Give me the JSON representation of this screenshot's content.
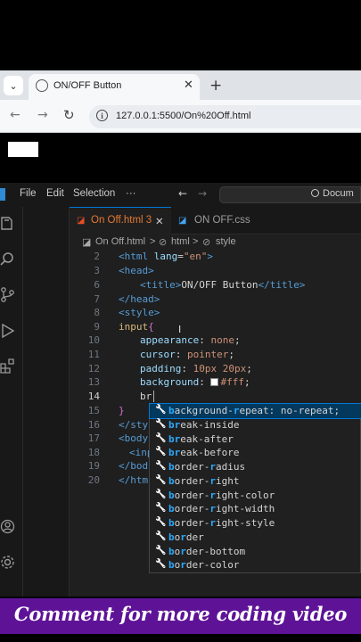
{
  "browser": {
    "tab_title": "ON/OFF Button",
    "tab_close": "✕",
    "new_tab": "+",
    "dropdown": "⌄",
    "url": "127.0.0.1:5500/On%20Off.html",
    "info": "i"
  },
  "vscode": {
    "menu": [
      "File",
      "Edit",
      "Selection",
      "···"
    ],
    "command_center": "Docum",
    "tabs": [
      {
        "label": "On Off.html",
        "badge": "3",
        "close": "✕"
      },
      {
        "label": "ON OFF.css"
      }
    ],
    "breadcrumb": [
      "On Off.html",
      ">",
      "html",
      ">",
      "style"
    ],
    "line_numbers": [
      "2",
      "3",
      "6",
      "7",
      "8",
      "9",
      "10",
      "11",
      "12",
      "13",
      "14",
      "15",
      "16",
      "17",
      "18",
      "19",
      "20"
    ],
    "code": {
      "l2": {
        "open": "<html",
        "attr": " lang",
        "eq": "=",
        "val": "\"en\"",
        "close": ">"
      },
      "l3": "<head>",
      "l6": {
        "open": "<title>",
        "text": "ON/OFF Button",
        "close": "</title>"
      },
      "l7": "</head>",
      "l8": "<style>",
      "l9": {
        "sel": "input",
        "brace": "{"
      },
      "l10": {
        "prop": "appearance",
        "colon": ": ",
        "val": "none",
        "semi": ";"
      },
      "l11": {
        "prop": "cursor",
        "colon": ": ",
        "val": "pointer",
        "semi": ";"
      },
      "l12": {
        "prop": "padding",
        "colon": ": ",
        "val": "10px 20px",
        "semi": ";"
      },
      "l13": {
        "prop": "background",
        "colon": ": ",
        "val": "#fff",
        "semi": ";"
      },
      "l14": "br",
      "l15": "}",
      "l16": "</styl",
      "l17": "<body",
      "l18": "<inp",
      "l19": "</body",
      "l20": "</html"
    },
    "suggestions": [
      {
        "match": "b",
        "mid": "ackground-",
        "match2": "r",
        "rest": "epeat: no-repeat;"
      },
      {
        "match": "br",
        "rest": "eak-inside"
      },
      {
        "match": "br",
        "rest": "eak-after"
      },
      {
        "match": "br",
        "rest": "eak-before"
      },
      {
        "match": "b",
        "mid": "order-",
        "match2": "r",
        "rest": "adius"
      },
      {
        "match": "b",
        "mid": "order-",
        "match2": "r",
        "rest": "ight"
      },
      {
        "match": "b",
        "mid": "order-",
        "match2": "r",
        "rest": "ight-color"
      },
      {
        "match": "b",
        "mid": "order-",
        "match2": "r",
        "rest": "ight-width"
      },
      {
        "match": "b",
        "mid": "order-",
        "match2": "r",
        "rest": "ight-style"
      },
      {
        "match": "b",
        "mid": "o",
        "match2": "r",
        "rest": "der"
      },
      {
        "match": "b",
        "mid": "o",
        "match2": "r",
        "rest": "der-bottom"
      },
      {
        "match": "b",
        "mid": "o",
        "match2": "r",
        "rest": "der-color"
      }
    ],
    "suggestion_icon": "wrench-icon"
  },
  "banner": {
    "text": "Comment for more coding video",
    "color": "#5e1397"
  }
}
